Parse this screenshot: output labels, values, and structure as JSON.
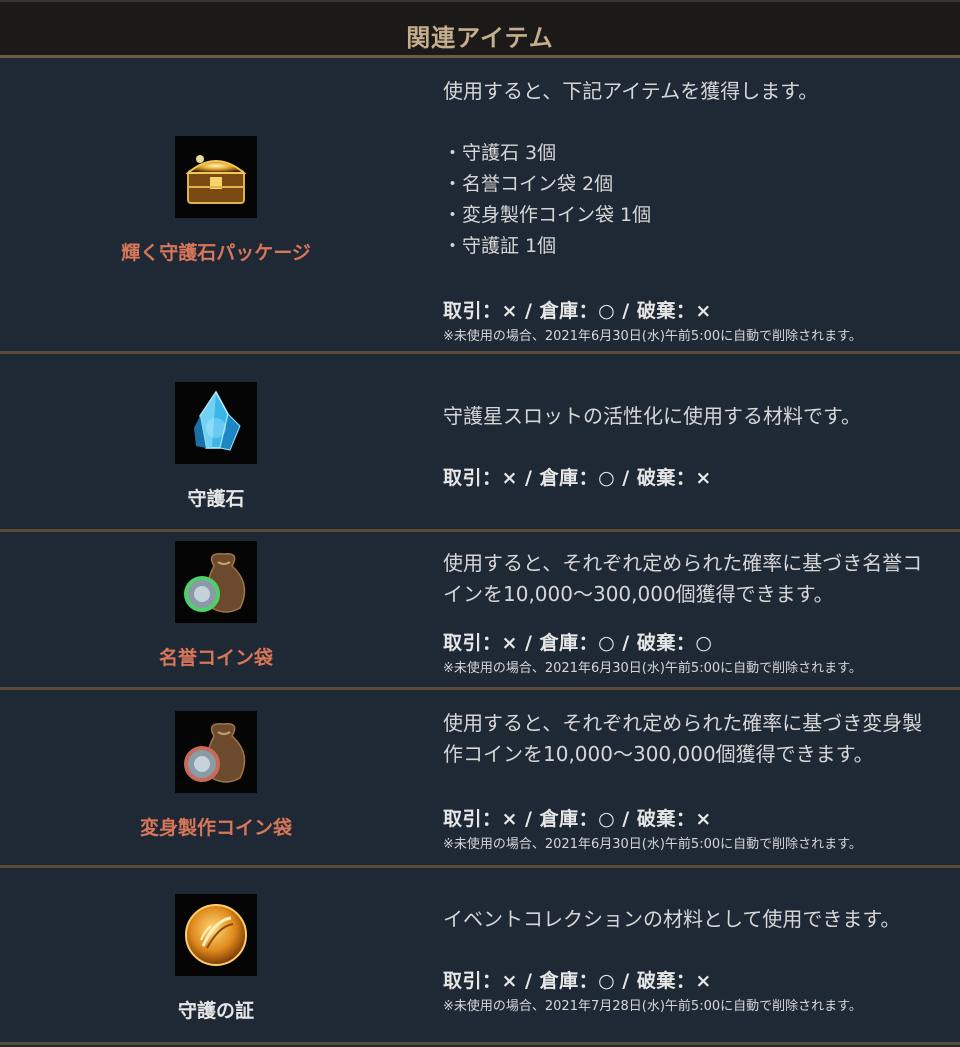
{
  "header": {
    "title": "関連アイテム"
  },
  "items": [
    {
      "name": "輝く守護石パッケージ",
      "icon": "treasure-chest-icon",
      "desc": "使用すると、下記アイテムを獲得します。",
      "contents": [
        "・守護石 3個",
        "・名誉コイン袋 2個",
        "・変身製作コイン袋 1個",
        "・守護証 1個"
      ],
      "rules": "取引：× / 倉庫：○ / 破棄：×",
      "note": "※未使用の場合、2021年6月30日(水)午前5:00に自動で削除されます。"
    },
    {
      "name": "守護石",
      "icon": "blue-crystal-icon",
      "desc": "守護星スロットの活性化に使用する材料です。",
      "rules": "取引：× / 倉庫：○ / 破棄：×"
    },
    {
      "name": "名誉コイン袋",
      "icon": "coin-bag-green-icon",
      "desc_line1": "使用すると、それぞれ定められた確率に基づき名誉コ",
      "desc_line2": "インを10,000～300,000個獲得できます。",
      "rules": "取引：× / 倉庫：○ / 破棄：○",
      "note": "※未使用の場合、2021年6月30日(水)午前5:00に自動で削除されます。"
    },
    {
      "name": "変身製作コイン袋",
      "icon": "coin-bag-red-icon",
      "desc_line1": "使用すると、それぞれ定められた確率に基づき変身製",
      "desc_line2": "作コインを10,000～300,000個獲得できます。",
      "rules": "取引：× / 倉庫：○ / 破棄：×",
      "note": "※未使用の場合、2021年6月30日(水)午前5:00に自動で削除されます。"
    },
    {
      "name": "守護の証",
      "icon": "golden-emblem-icon",
      "desc": "イベントコレクションの材料として使用できます。",
      "rules": "取引：× / 倉庫：○ / 破棄：×",
      "note": "※未使用の場合、2021年7月28日(水)午前5:00に自動で削除されます。"
    }
  ],
  "colors": {
    "background": "#1f2935",
    "header_bg": "#1b1a19",
    "header_text": "#c4ae8c",
    "divider": "#5a4a38",
    "name_highlight": "#d8765a"
  }
}
